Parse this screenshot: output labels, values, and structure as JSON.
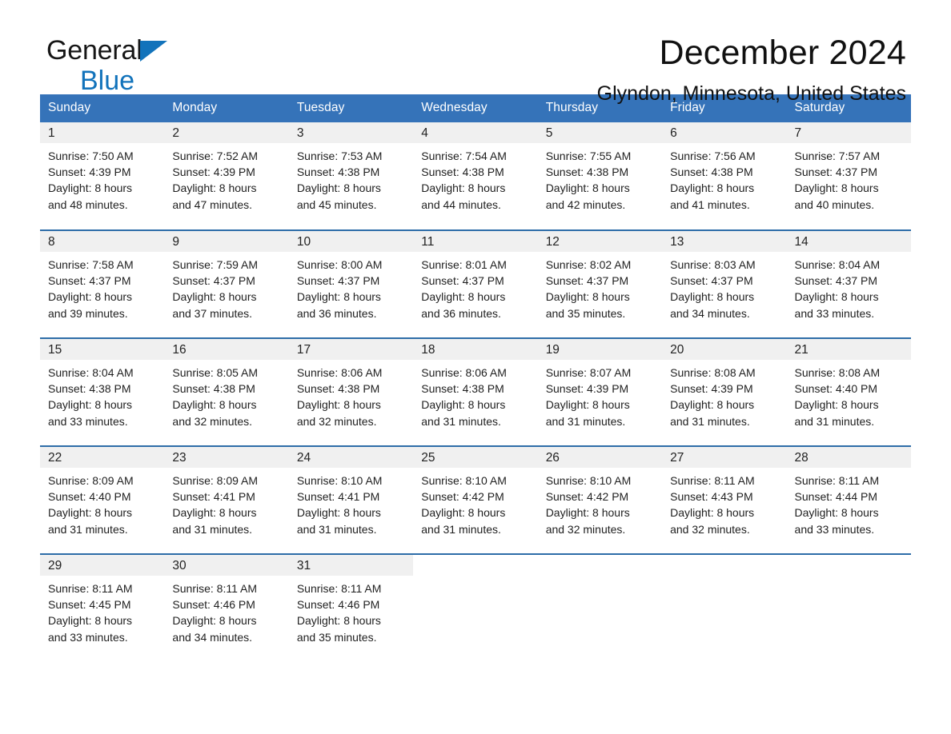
{
  "brand": {
    "name_part1": "General",
    "name_part2": "Blue",
    "logo_icon": "triangle-flag-icon",
    "accent_color": "#1273bb"
  },
  "header": {
    "month_title": "December 2024",
    "location": "Glyndon, Minnesota, United States"
  },
  "theme": {
    "header_row_bg": "#3573b9",
    "row_divider": "#2e6da8",
    "daynum_bg": "#f0f0f0"
  },
  "calendar": {
    "weekday_headers": [
      "Sunday",
      "Monday",
      "Tuesday",
      "Wednesday",
      "Thursday",
      "Friday",
      "Saturday"
    ],
    "weeks": [
      [
        {
          "day": "1",
          "sunrise": "Sunrise: 7:50 AM",
          "sunset": "Sunset: 4:39 PM",
          "daylight_line1": "Daylight: 8 hours",
          "daylight_line2": "and 48 minutes."
        },
        {
          "day": "2",
          "sunrise": "Sunrise: 7:52 AM",
          "sunset": "Sunset: 4:39 PM",
          "daylight_line1": "Daylight: 8 hours",
          "daylight_line2": "and 47 minutes."
        },
        {
          "day": "3",
          "sunrise": "Sunrise: 7:53 AM",
          "sunset": "Sunset: 4:38 PM",
          "daylight_line1": "Daylight: 8 hours",
          "daylight_line2": "and 45 minutes."
        },
        {
          "day": "4",
          "sunrise": "Sunrise: 7:54 AM",
          "sunset": "Sunset: 4:38 PM",
          "daylight_line1": "Daylight: 8 hours",
          "daylight_line2": "and 44 minutes."
        },
        {
          "day": "5",
          "sunrise": "Sunrise: 7:55 AM",
          "sunset": "Sunset: 4:38 PM",
          "daylight_line1": "Daylight: 8 hours",
          "daylight_line2": "and 42 minutes."
        },
        {
          "day": "6",
          "sunrise": "Sunrise: 7:56 AM",
          "sunset": "Sunset: 4:38 PM",
          "daylight_line1": "Daylight: 8 hours",
          "daylight_line2": "and 41 minutes."
        },
        {
          "day": "7",
          "sunrise": "Sunrise: 7:57 AM",
          "sunset": "Sunset: 4:37 PM",
          "daylight_line1": "Daylight: 8 hours",
          "daylight_line2": "and 40 minutes."
        }
      ],
      [
        {
          "day": "8",
          "sunrise": "Sunrise: 7:58 AM",
          "sunset": "Sunset: 4:37 PM",
          "daylight_line1": "Daylight: 8 hours",
          "daylight_line2": "and 39 minutes."
        },
        {
          "day": "9",
          "sunrise": "Sunrise: 7:59 AM",
          "sunset": "Sunset: 4:37 PM",
          "daylight_line1": "Daylight: 8 hours",
          "daylight_line2": "and 37 minutes."
        },
        {
          "day": "10",
          "sunrise": "Sunrise: 8:00 AM",
          "sunset": "Sunset: 4:37 PM",
          "daylight_line1": "Daylight: 8 hours",
          "daylight_line2": "and 36 minutes."
        },
        {
          "day": "11",
          "sunrise": "Sunrise: 8:01 AM",
          "sunset": "Sunset: 4:37 PM",
          "daylight_line1": "Daylight: 8 hours",
          "daylight_line2": "and 36 minutes."
        },
        {
          "day": "12",
          "sunrise": "Sunrise: 8:02 AM",
          "sunset": "Sunset: 4:37 PM",
          "daylight_line1": "Daylight: 8 hours",
          "daylight_line2": "and 35 minutes."
        },
        {
          "day": "13",
          "sunrise": "Sunrise: 8:03 AM",
          "sunset": "Sunset: 4:37 PM",
          "daylight_line1": "Daylight: 8 hours",
          "daylight_line2": "and 34 minutes."
        },
        {
          "day": "14",
          "sunrise": "Sunrise: 8:04 AM",
          "sunset": "Sunset: 4:37 PM",
          "daylight_line1": "Daylight: 8 hours",
          "daylight_line2": "and 33 minutes."
        }
      ],
      [
        {
          "day": "15",
          "sunrise": "Sunrise: 8:04 AM",
          "sunset": "Sunset: 4:38 PM",
          "daylight_line1": "Daylight: 8 hours",
          "daylight_line2": "and 33 minutes."
        },
        {
          "day": "16",
          "sunrise": "Sunrise: 8:05 AM",
          "sunset": "Sunset: 4:38 PM",
          "daylight_line1": "Daylight: 8 hours",
          "daylight_line2": "and 32 minutes."
        },
        {
          "day": "17",
          "sunrise": "Sunrise: 8:06 AM",
          "sunset": "Sunset: 4:38 PM",
          "daylight_line1": "Daylight: 8 hours",
          "daylight_line2": "and 32 minutes."
        },
        {
          "day": "18",
          "sunrise": "Sunrise: 8:06 AM",
          "sunset": "Sunset: 4:38 PM",
          "daylight_line1": "Daylight: 8 hours",
          "daylight_line2": "and 31 minutes."
        },
        {
          "day": "19",
          "sunrise": "Sunrise: 8:07 AM",
          "sunset": "Sunset: 4:39 PM",
          "daylight_line1": "Daylight: 8 hours",
          "daylight_line2": "and 31 minutes."
        },
        {
          "day": "20",
          "sunrise": "Sunrise: 8:08 AM",
          "sunset": "Sunset: 4:39 PM",
          "daylight_line1": "Daylight: 8 hours",
          "daylight_line2": "and 31 minutes."
        },
        {
          "day": "21",
          "sunrise": "Sunrise: 8:08 AM",
          "sunset": "Sunset: 4:40 PM",
          "daylight_line1": "Daylight: 8 hours",
          "daylight_line2": "and 31 minutes."
        }
      ],
      [
        {
          "day": "22",
          "sunrise": "Sunrise: 8:09 AM",
          "sunset": "Sunset: 4:40 PM",
          "daylight_line1": "Daylight: 8 hours",
          "daylight_line2": "and 31 minutes."
        },
        {
          "day": "23",
          "sunrise": "Sunrise: 8:09 AM",
          "sunset": "Sunset: 4:41 PM",
          "daylight_line1": "Daylight: 8 hours",
          "daylight_line2": "and 31 minutes."
        },
        {
          "day": "24",
          "sunrise": "Sunrise: 8:10 AM",
          "sunset": "Sunset: 4:41 PM",
          "daylight_line1": "Daylight: 8 hours",
          "daylight_line2": "and 31 minutes."
        },
        {
          "day": "25",
          "sunrise": "Sunrise: 8:10 AM",
          "sunset": "Sunset: 4:42 PM",
          "daylight_line1": "Daylight: 8 hours",
          "daylight_line2": "and 31 minutes."
        },
        {
          "day": "26",
          "sunrise": "Sunrise: 8:10 AM",
          "sunset": "Sunset: 4:42 PM",
          "daylight_line1": "Daylight: 8 hours",
          "daylight_line2": "and 32 minutes."
        },
        {
          "day": "27",
          "sunrise": "Sunrise: 8:11 AM",
          "sunset": "Sunset: 4:43 PM",
          "daylight_line1": "Daylight: 8 hours",
          "daylight_line2": "and 32 minutes."
        },
        {
          "day": "28",
          "sunrise": "Sunrise: 8:11 AM",
          "sunset": "Sunset: 4:44 PM",
          "daylight_line1": "Daylight: 8 hours",
          "daylight_line2": "and 33 minutes."
        }
      ],
      [
        {
          "day": "29",
          "sunrise": "Sunrise: 8:11 AM",
          "sunset": "Sunset: 4:45 PM",
          "daylight_line1": "Daylight: 8 hours",
          "daylight_line2": "and 33 minutes."
        },
        {
          "day": "30",
          "sunrise": "Sunrise: 8:11 AM",
          "sunset": "Sunset: 4:46 PM",
          "daylight_line1": "Daylight: 8 hours",
          "daylight_line2": "and 34 minutes."
        },
        {
          "day": "31",
          "sunrise": "Sunrise: 8:11 AM",
          "sunset": "Sunset: 4:46 PM",
          "daylight_line1": "Daylight: 8 hours",
          "daylight_line2": "and 35 minutes."
        },
        {
          "day": "",
          "sunrise": "",
          "sunset": "",
          "daylight_line1": "",
          "daylight_line2": ""
        },
        {
          "day": "",
          "sunrise": "",
          "sunset": "",
          "daylight_line1": "",
          "daylight_line2": ""
        },
        {
          "day": "",
          "sunrise": "",
          "sunset": "",
          "daylight_line1": "",
          "daylight_line2": ""
        },
        {
          "day": "",
          "sunrise": "",
          "sunset": "",
          "daylight_line1": "",
          "daylight_line2": ""
        }
      ]
    ]
  }
}
